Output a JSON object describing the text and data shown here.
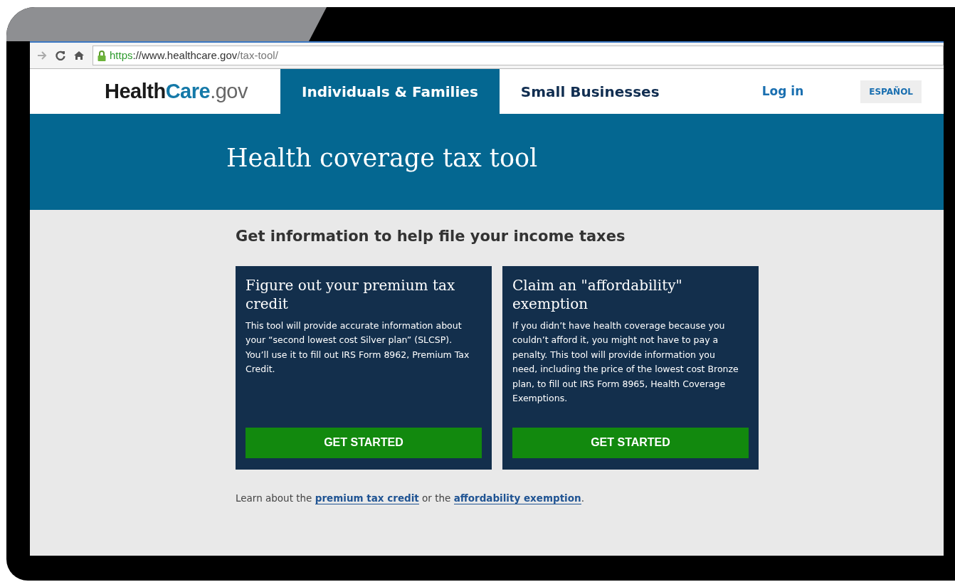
{
  "browser": {
    "address": {
      "scheme": "https",
      "host": "://www.healthcare.gov",
      "path": "/tax-tool/"
    }
  },
  "header": {
    "logo": [
      "Health",
      "Care",
      ".gov"
    ],
    "tabs": [
      {
        "label": "Individuals & Families",
        "selected": true
      },
      {
        "label": "Small Businesses",
        "selected": false
      }
    ],
    "login": "Log in",
    "language": "ESPAÑOL"
  },
  "banner": {
    "title": "Health coverage tax tool"
  },
  "content": {
    "heading": "Get information to help file your income taxes",
    "cards": [
      {
        "title": "Figure out your premium tax credit",
        "text": "This tool will provide accurate information about your “second lowest cost Silver plan” (SLCSP). You’ll use it to fill out IRS Form 8962, Premium Tax Credit.",
        "button": "GET STARTED"
      },
      {
        "title": "Claim an \"affordability\" exemption",
        "text": "If you didn’t have health coverage because you couldn’t afford it, you might not have to pay a penalty. This tool will provide information you need, including the price of the lowest cost Bronze plan, to fill out IRS Form 8965, Health Coverage Exemptions.",
        "button": "GET STARTED"
      }
    ],
    "footnote": {
      "before": "Learn about the ",
      "link1": "premium tax credit",
      "middle": " or the ",
      "link2": "affordability exemption",
      "after": "."
    }
  }
}
